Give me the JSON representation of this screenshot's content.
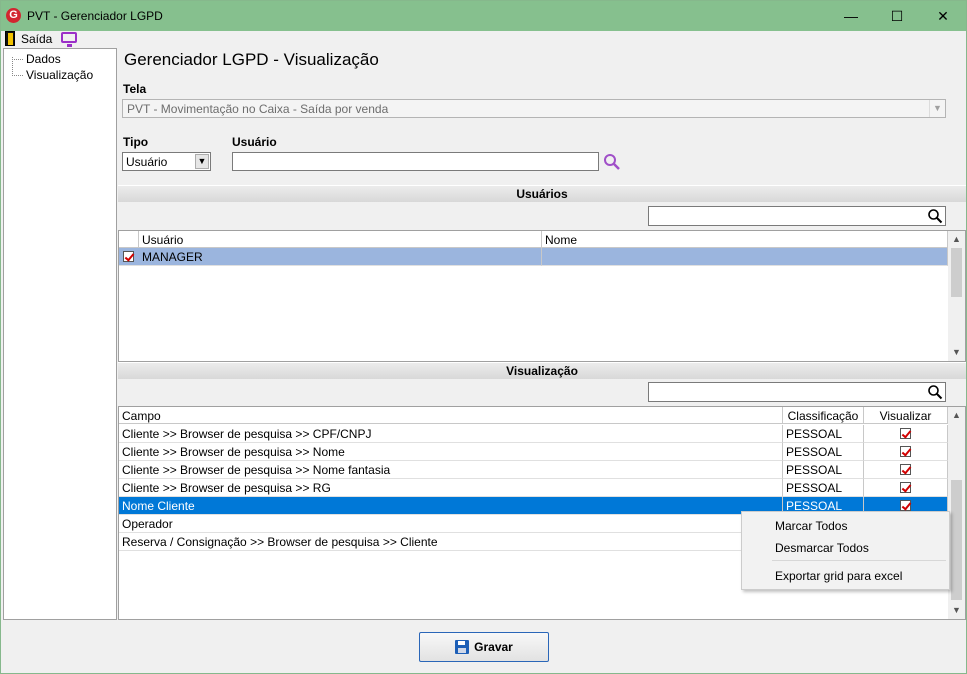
{
  "window": {
    "title": "PVT - Gerenciador LGPD",
    "logo_letter": "G",
    "controls": {
      "minimize": "—",
      "maximize": "☐",
      "close": "✕"
    }
  },
  "toolbar": {
    "exit_label": "Saída"
  },
  "tree": {
    "items": [
      "Dados",
      "Visualização"
    ]
  },
  "page_title": "Gerenciador LGPD - Visualização",
  "tela": {
    "label": "Tela",
    "value": "PVT - Movimentação no Caixa - Saída por venda"
  },
  "tipo": {
    "label": "Tipo",
    "value": "Usuário"
  },
  "usuario": {
    "label": "Usuário",
    "value": ""
  },
  "users_section": {
    "title": "Usuários",
    "search_value": "",
    "columns": [
      "Usuário",
      "Nome"
    ],
    "rows": [
      {
        "checked": true,
        "usuario": "MANAGER",
        "nome": ""
      }
    ]
  },
  "view_section": {
    "title": "Visualização",
    "search_value": "",
    "columns": [
      "Campo",
      "Classificação",
      "Visualizar"
    ],
    "rows": [
      {
        "campo": "Cliente >> Browser de pesquisa >> CPF/CNPJ",
        "classificacao": "PESSOAL",
        "visualizar": true
      },
      {
        "campo": "Cliente >> Browser de pesquisa >> Nome",
        "classificacao": "PESSOAL",
        "visualizar": true
      },
      {
        "campo": "Cliente >> Browser de pesquisa >> Nome fantasia",
        "classificacao": "PESSOAL",
        "visualizar": true
      },
      {
        "campo": "Cliente >> Browser de pesquisa >> RG",
        "classificacao": "PESSOAL",
        "visualizar": true
      },
      {
        "campo": "Nome Cliente",
        "classificacao": "PESSOAL",
        "visualizar": true,
        "selected": true
      },
      {
        "campo": "Operador",
        "classificacao": "",
        "visualizar": null
      },
      {
        "campo": "Reserva / Consignação >> Browser de pesquisa >> Cliente",
        "classificacao": "",
        "visualizar": null
      }
    ]
  },
  "context_menu": {
    "items": [
      "Marcar Todos",
      "Desmarcar Todos",
      "Exportar grid para excel"
    ]
  },
  "save_button": {
    "label": "Gravar"
  },
  "colors": {
    "titlebar": "#86c08e",
    "selection": "#0078d7",
    "user_row_selection": "#9bb5de",
    "check": "#d10000"
  }
}
